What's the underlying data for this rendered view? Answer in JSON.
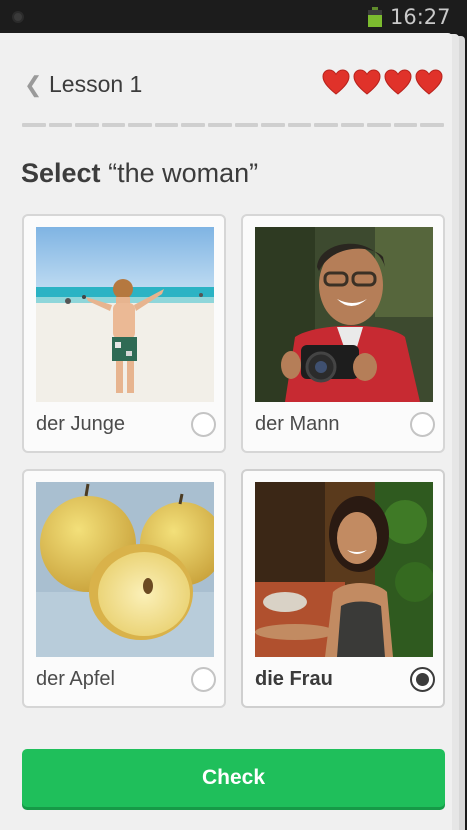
{
  "status_bar": {
    "time": "16:27",
    "icons": [
      "notification-dot-icon",
      "battery-icon"
    ]
  },
  "header": {
    "back_icon": "chevron-left-icon",
    "lesson_title": "Lesson 1",
    "hearts": 4,
    "heart_color": "#e0322a"
  },
  "progress": {
    "segments": 16,
    "completed": 0
  },
  "prompt": {
    "verb": "Select",
    "phrase": "“the woman”"
  },
  "options": [
    {
      "label": "der Junge",
      "image": "boy-on-beach-image",
      "selected": false
    },
    {
      "label": "der Mann",
      "image": "man-with-camera-image",
      "selected": false
    },
    {
      "label": "der Apfel",
      "image": "apples-image",
      "selected": false
    },
    {
      "label": "die Frau",
      "image": "woman-smiling-image",
      "selected": true
    }
  ],
  "actions": {
    "check_label": "Check",
    "check_color": "#1fbf5b"
  }
}
